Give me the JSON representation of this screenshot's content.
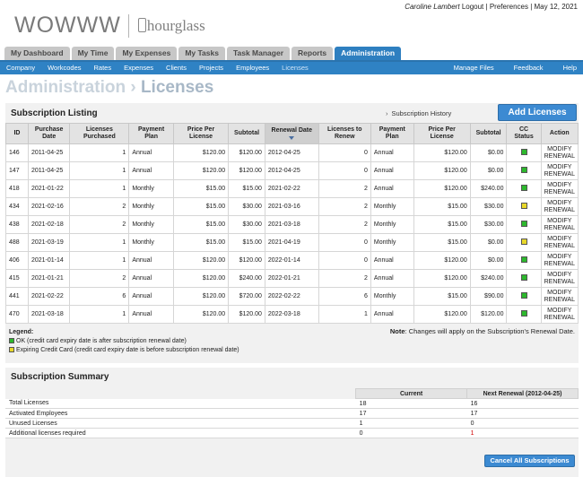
{
  "brand": {
    "name": "WOWWW",
    "partner": "hourglass"
  },
  "user": {
    "name": "Caroline Lambert",
    "logout": "Logout",
    "preferences": "Preferences",
    "date": "May 12, 2021",
    "sep": "|"
  },
  "tabs": [
    {
      "label": "My Dashboard",
      "active": false
    },
    {
      "label": "My Time",
      "active": false
    },
    {
      "label": "My Expenses",
      "active": false
    },
    {
      "label": "My Tasks",
      "active": false
    },
    {
      "label": "Task Manager",
      "active": false
    },
    {
      "label": "Reports",
      "active": false
    },
    {
      "label": "Administration",
      "active": true
    }
  ],
  "subnav": {
    "left": [
      {
        "label": "Company",
        "active": false
      },
      {
        "label": "Workcodes",
        "active": false
      },
      {
        "label": "Rates",
        "active": false
      },
      {
        "label": "Expenses",
        "active": false
      },
      {
        "label": "Clients",
        "active": false
      },
      {
        "label": "Projects",
        "active": false
      },
      {
        "label": "Employees",
        "active": false
      },
      {
        "label": "Licenses",
        "active": true
      }
    ],
    "right": [
      "Manage Files",
      "Feedback",
      "Help"
    ]
  },
  "page": {
    "section": "Administration",
    "arrow": "›",
    "title": "Licenses"
  },
  "listing": {
    "title": "Subscription Listing",
    "history_link": "Subscription History",
    "add_button": "Add Licenses",
    "columns": [
      "ID",
      "Purchase Date",
      "Licenses Purchased",
      "Payment Plan",
      "Price Per License",
      "Subtotal",
      "Renewal Date",
      "Licenses to Renew",
      "Payment Plan",
      "Price Per License",
      "Subtotal",
      "CC Status",
      "Action"
    ],
    "rows": [
      {
        "id": "146",
        "purchase_date": "2011-04-25",
        "purchased": "1",
        "plan": "Annual",
        "price": "$120.00",
        "subtotal": "$120.00",
        "renewal_date": "2012-04-25",
        "renew_count": "0",
        "renew_plan": "Annual",
        "renew_price": "$120.00",
        "renew_subtotal": "$0.00",
        "cc": "green",
        "action": "MODIFY RENEWAL"
      },
      {
        "id": "147",
        "purchase_date": "2011-04-25",
        "purchased": "1",
        "plan": "Annual",
        "price": "$120.00",
        "subtotal": "$120.00",
        "renewal_date": "2012-04-25",
        "renew_count": "0",
        "renew_plan": "Annual",
        "renew_price": "$120.00",
        "renew_subtotal": "$0.00",
        "cc": "green",
        "action": "MODIFY RENEWAL"
      },
      {
        "id": "418",
        "purchase_date": "2021-01-22",
        "purchased": "1",
        "plan": "Monthly",
        "price": "$15.00",
        "subtotal": "$15.00",
        "renewal_date": "2021-02-22",
        "renew_count": "2",
        "renew_plan": "Annual",
        "renew_price": "$120.00",
        "renew_subtotal": "$240.00",
        "cc": "green",
        "action": "MODIFY RENEWAL"
      },
      {
        "id": "434",
        "purchase_date": "2021-02-16",
        "purchased": "2",
        "plan": "Monthly",
        "price": "$15.00",
        "subtotal": "$30.00",
        "renewal_date": "2021-03-16",
        "renew_count": "2",
        "renew_plan": "Monthly",
        "renew_price": "$15.00",
        "renew_subtotal": "$30.00",
        "cc": "yellow",
        "action": "MODIFY RENEWAL"
      },
      {
        "id": "438",
        "purchase_date": "2021-02-18",
        "purchased": "2",
        "plan": "Monthly",
        "price": "$15.00",
        "subtotal": "$30.00",
        "renewal_date": "2021-03-18",
        "renew_count": "2",
        "renew_plan": "Monthly",
        "renew_price": "$15.00",
        "renew_subtotal": "$30.00",
        "cc": "green",
        "action": "MODIFY RENEWAL"
      },
      {
        "id": "488",
        "purchase_date": "2021-03-19",
        "purchased": "1",
        "plan": "Monthly",
        "price": "$15.00",
        "subtotal": "$15.00",
        "renewal_date": "2021-04-19",
        "renew_count": "0",
        "renew_plan": "Monthly",
        "renew_price": "$15.00",
        "renew_subtotal": "$0.00",
        "cc": "yellow",
        "action": "MODIFY RENEWAL"
      },
      {
        "id": "406",
        "purchase_date": "2021-01-14",
        "purchased": "1",
        "plan": "Annual",
        "price": "$120.00",
        "subtotal": "$120.00",
        "renewal_date": "2022-01-14",
        "renew_count": "0",
        "renew_plan": "Annual",
        "renew_price": "$120.00",
        "renew_subtotal": "$0.00",
        "cc": "green",
        "action": "MODIFY RENEWAL"
      },
      {
        "id": "415",
        "purchase_date": "2021-01-21",
        "purchased": "2",
        "plan": "Annual",
        "price": "$120.00",
        "subtotal": "$240.00",
        "renewal_date": "2022-01-21",
        "renew_count": "2",
        "renew_plan": "Annual",
        "renew_price": "$120.00",
        "renew_subtotal": "$240.00",
        "cc": "green",
        "action": "MODIFY RENEWAL"
      },
      {
        "id": "441",
        "purchase_date": "2021-02-22",
        "purchased": "6",
        "plan": "Annual",
        "price": "$120.00",
        "subtotal": "$720.00",
        "renewal_date": "2022-02-22",
        "renew_count": "6",
        "renew_plan": "Monthly",
        "renew_price": "$15.00",
        "renew_subtotal": "$90.00",
        "cc": "green",
        "action": "MODIFY RENEWAL"
      },
      {
        "id": "470",
        "purchase_date": "2021-03-18",
        "purchased": "1",
        "plan": "Annual",
        "price": "$120.00",
        "subtotal": "$120.00",
        "renewal_date": "2022-03-18",
        "renew_count": "1",
        "renew_plan": "Annual",
        "renew_price": "$120.00",
        "renew_subtotal": "$120.00",
        "cc": "green",
        "action": "MODIFY RENEWAL"
      }
    ],
    "legend_title": "Legend:",
    "legend_ok": "OK (credit card expiry date is after subscription renewal date)",
    "legend_expiring": "Expiring Credit Card (credit card expiry date is before subscription renewal date)",
    "note_label": "Note",
    "note_text": ": Changes will apply on the Subscription's Renewal Date."
  },
  "summary": {
    "title": "Subscription Summary",
    "col_current": "Current",
    "col_next": "Next Renewal (2012-04-25)",
    "rows": [
      {
        "label": "Total Licenses",
        "current": "18",
        "next": "16",
        "next_red": false
      },
      {
        "label": "Activated Employees",
        "current": "17",
        "next": "17",
        "next_red": false
      },
      {
        "label": "Unused Licenses",
        "current": "1",
        "next": "0",
        "next_red": false
      },
      {
        "label": "Additional licenses required",
        "current": "0",
        "next": "1",
        "next_red": true
      }
    ],
    "cancel_button": "Cancel All Subscriptions"
  },
  "colors": {
    "accent": "#2f82c4",
    "ok": "#2db82d",
    "expiring": "#e8d82a",
    "alert": "#d00000"
  }
}
